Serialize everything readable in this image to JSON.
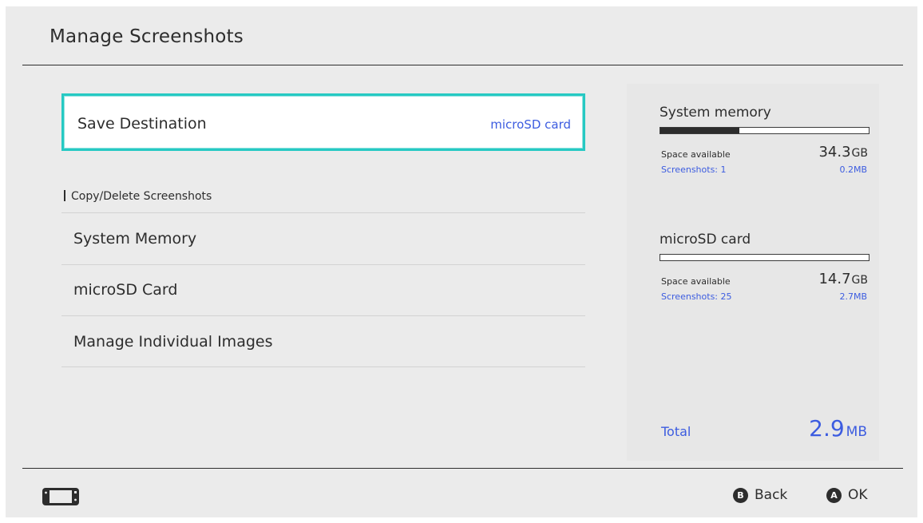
{
  "header": {
    "title": "Manage Screenshots"
  },
  "menu": {
    "save_destination": {
      "label": "Save Destination",
      "value": "microSD card"
    },
    "section_header": "Copy/Delete Screenshots",
    "items": [
      {
        "label": "System Memory"
      },
      {
        "label": "microSD Card"
      },
      {
        "label": "Manage Individual Images"
      }
    ]
  },
  "storage": {
    "system_memory": {
      "title": "System memory",
      "usage_fraction": 0.38,
      "space_available_label": "Space available",
      "space_available_value": "34.3",
      "space_available_unit": "GB",
      "screenshots_label": "Screenshots: 1",
      "screenshots_size": "0.2MB"
    },
    "microsd_card": {
      "title": "microSD card",
      "usage_fraction": 0.0,
      "space_available_label": "Space available",
      "space_available_value": "14.7",
      "space_available_unit": "GB",
      "screenshots_label": "Screenshots: 25",
      "screenshots_size": "2.7MB"
    },
    "total": {
      "label": "Total",
      "value": "2.9",
      "unit": "MB"
    }
  },
  "footer": {
    "console_icon": "handheld-console-icon",
    "back": {
      "button": "B",
      "label": "Back"
    },
    "ok": {
      "button": "A",
      "label": "OK"
    }
  },
  "colors": {
    "accent_blue": "#3c5ce0",
    "focus_cyan": "#26c9c3",
    "background": "#ebebeb",
    "text": "#2d2d2d"
  }
}
